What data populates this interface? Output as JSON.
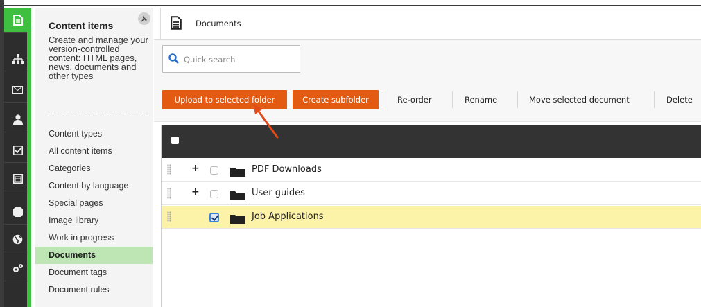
{
  "rail": {
    "items": [
      {
        "icon": "document-icon",
        "active": true
      },
      {
        "icon": "sitemap-icon",
        "active": false
      },
      {
        "icon": "mail-icon",
        "active": false
      },
      {
        "icon": "user-icon",
        "active": false
      },
      {
        "icon": "checkbox-icon",
        "active": false
      },
      {
        "icon": "calendar-icon",
        "active": false
      },
      {
        "icon": "puzzle-icon",
        "active": false
      },
      {
        "icon": "globe-icon",
        "active": false
      },
      {
        "icon": "gears-icon",
        "active": false
      }
    ]
  },
  "sidebar": {
    "title": "Content items",
    "description": "Create and manage your version-controlled content: HTML pages, news, documents and other types",
    "items": [
      {
        "label": "Content types",
        "active": false
      },
      {
        "label": "All content items",
        "active": false
      },
      {
        "label": "Categories",
        "active": false
      },
      {
        "label": "Content by language",
        "active": false
      },
      {
        "label": "Special pages",
        "active": false
      },
      {
        "label": "Image library",
        "active": false
      },
      {
        "label": "Work in progress",
        "active": false
      },
      {
        "label": "Documents",
        "active": true
      },
      {
        "label": "Document tags",
        "active": false
      },
      {
        "label": "Document rules",
        "active": false
      }
    ]
  },
  "breadcrumb": {
    "title": "Documents"
  },
  "search": {
    "placeholder": "Quick search"
  },
  "toolbar": {
    "upload_label": "Upload to selected folder",
    "create_subfolder_label": "Create subfolder",
    "reorder_label": "Re-order",
    "rename_label": "Rename",
    "move_label": "Move selected document",
    "delete_label": "Delete"
  },
  "folders": [
    {
      "name": "PDF Downloads",
      "expandable": true,
      "checked": false,
      "selected": false
    },
    {
      "name": "User guides",
      "expandable": true,
      "checked": false,
      "selected": false
    },
    {
      "name": "Job Applications",
      "expandable": false,
      "checked": true,
      "selected": true
    }
  ],
  "colors": {
    "accent_green": "#3fbf3f",
    "button_orange": "#e35a13",
    "selected_row": "#fdf3a8",
    "rail_dark": "#2d2d2d"
  }
}
